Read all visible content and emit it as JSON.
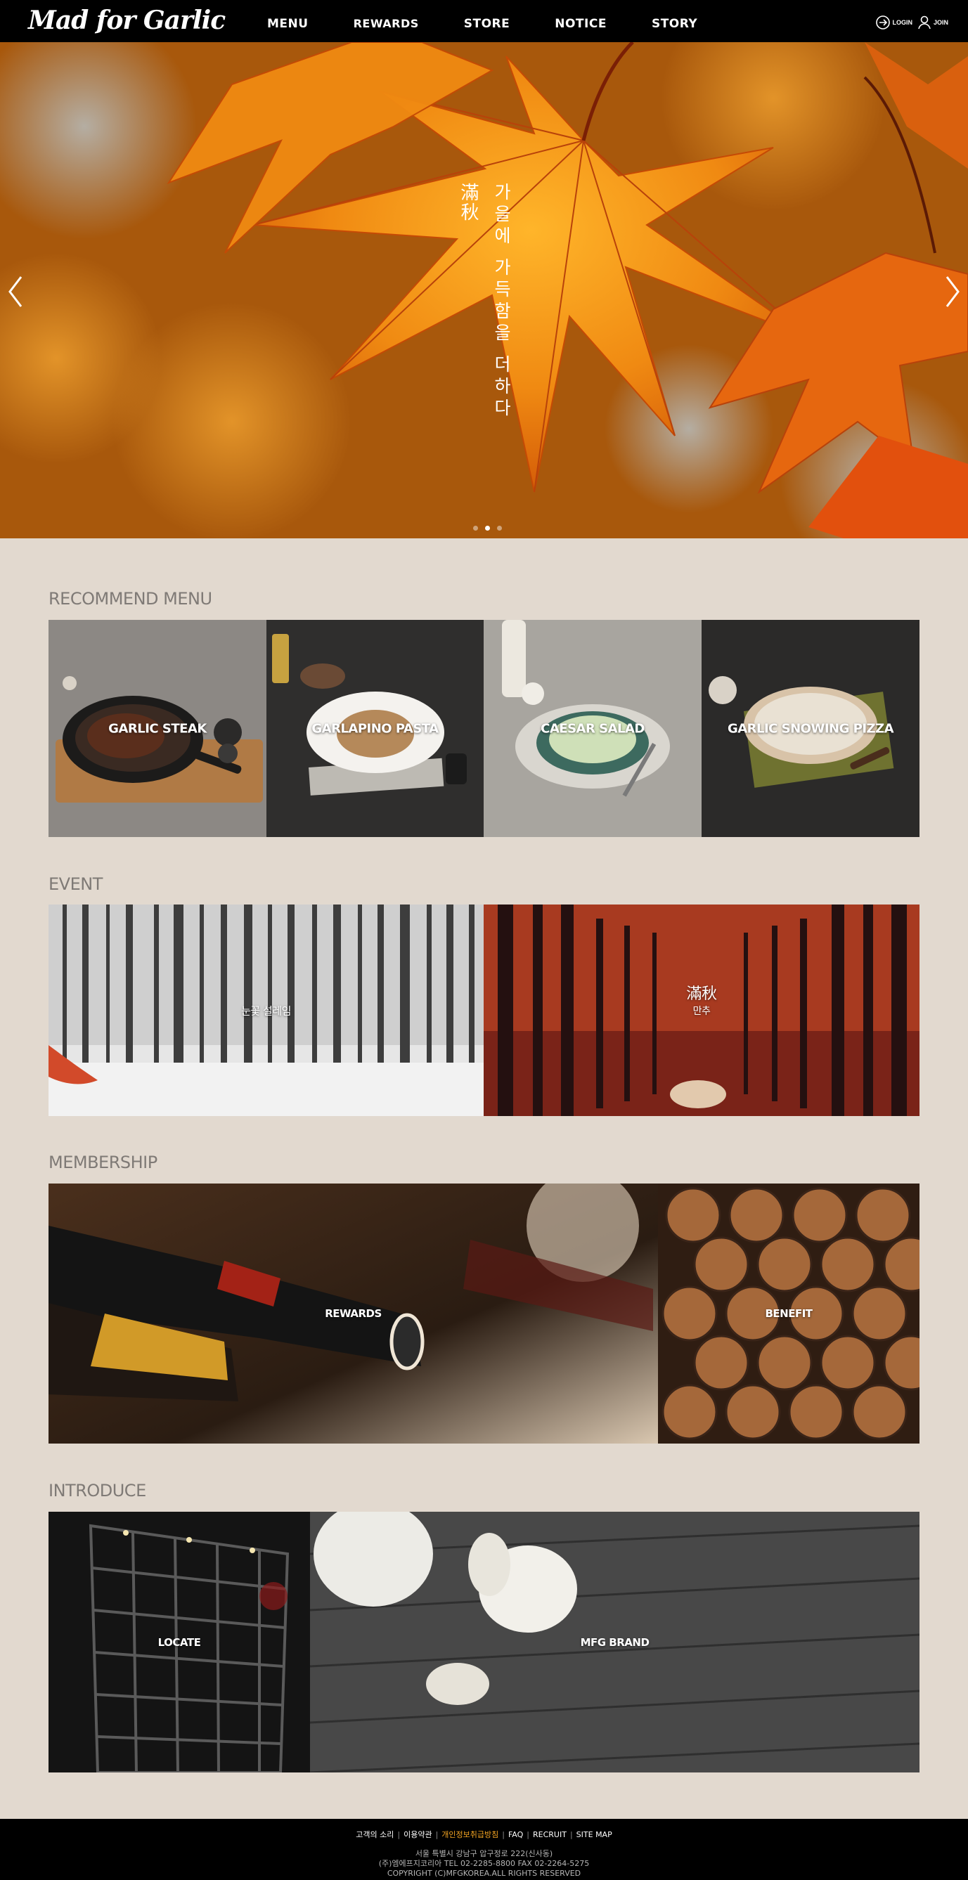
{
  "header": {
    "logo": "Mad for Garlic",
    "nav": [
      {
        "label": "MENU"
      },
      {
        "label": "REWARDS"
      },
      {
        "label": "STORE"
      },
      {
        "label": "NOTICE"
      },
      {
        "label": "STORY"
      }
    ],
    "login_label": "LOGIN",
    "join_label": "JOIN"
  },
  "hero": {
    "chinese_text": "滿秋",
    "korean_text": "가을에 가득함을 더하다",
    "slides_total": 3,
    "active_slide": 2
  },
  "sections": {
    "recommend": {
      "title": "RECOMMEND MENU",
      "items": [
        {
          "label": "GARLIC STEAK"
        },
        {
          "label": "GARLAPINO PASTA"
        },
        {
          "label": "CAESAR SALAD"
        },
        {
          "label": "GARLIC SNOWING PIZZA"
        }
      ]
    },
    "event": {
      "title": "EVENT",
      "items": [
        {
          "label": "눈꽃 설레임"
        },
        {
          "label_cn": "滿秋",
          "label": "만추"
        }
      ]
    },
    "membership": {
      "title": "MEMBERSHIP",
      "items": [
        {
          "label": "REWARDS"
        },
        {
          "label": "BENEFIT"
        }
      ]
    },
    "introduce": {
      "title": "INTRODUCE",
      "items": [
        {
          "label": "LOCATE"
        },
        {
          "label": "MFG BRAND"
        }
      ]
    }
  },
  "footer": {
    "links": [
      {
        "label": "고객의 소리"
      },
      {
        "label": "이용약관"
      },
      {
        "label": "개인정보취급방침",
        "highlight": true
      },
      {
        "label": "FAQ"
      },
      {
        "label": "RECRUIT"
      },
      {
        "label": "SITE MAP"
      }
    ],
    "address": "서울 특별시 강남구 압구정로 222(신사동)",
    "company": "(주)엠에프지코리아 TEL 02-2285-8800 FAX 02-2264-5275",
    "copyright": "COPYRIGHT (C)MFGKOREA.ALL RIGHTS RESERVED"
  },
  "colors": {
    "background": "#e2d9cf",
    "header": "#000000",
    "section_title": "#7f7a76",
    "footer_highlight": "#f5a623"
  }
}
